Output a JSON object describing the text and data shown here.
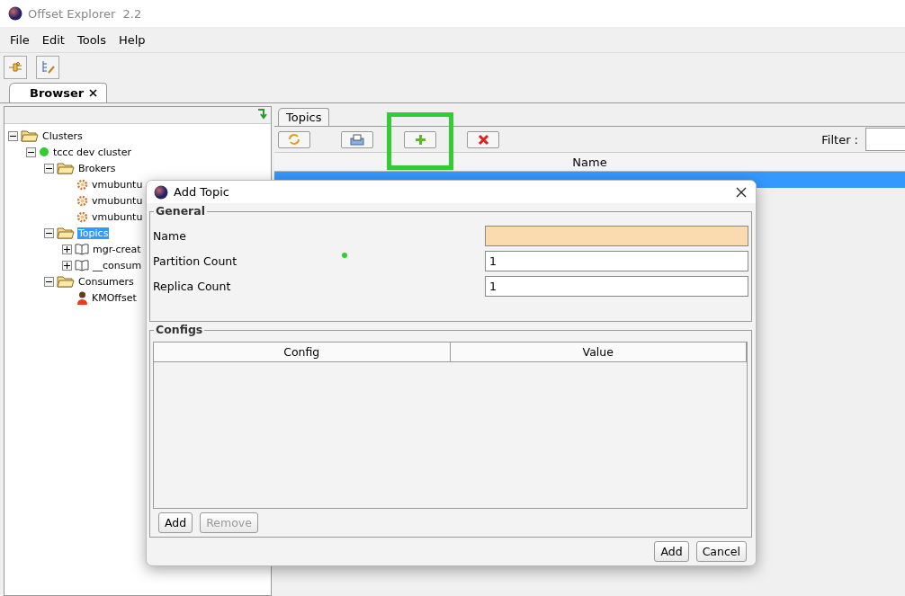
{
  "window": {
    "title": "Offset Explorer  2.2"
  },
  "menu": [
    "File",
    "Edit",
    "Tools",
    "Help"
  ],
  "browser_tab": {
    "label": "Browser",
    "selected": true
  },
  "tree": [
    {
      "label": "Clusters",
      "kind": "folder",
      "expanded": true,
      "selected": false,
      "children": [
        {
          "label": "tccc dev cluster",
          "kind": "cluster",
          "expanded": true,
          "selected": false,
          "children": [
            {
              "label": "Brokers",
              "kind": "folder",
              "expanded": true,
              "selected": false,
              "children": [
                {
                  "label": "vmubuntu",
                  "kind": "broker",
                  "selected": false
                },
                {
                  "label": "vmubuntu",
                  "kind": "broker",
                  "selected": false
                },
                {
                  "label": "vmubuntu",
                  "kind": "broker",
                  "selected": false
                }
              ]
            },
            {
              "label": "Topics",
              "kind": "folder",
              "expanded": true,
              "selected": true,
              "children": [
                {
                  "label": "mgr-creat",
                  "kind": "topic",
                  "expanded": false,
                  "selected": false
                },
                {
                  "label": "__consum",
                  "kind": "topic",
                  "expanded": false,
                  "selected": false
                }
              ]
            },
            {
              "label": "Consumers",
              "kind": "folder",
              "expanded": true,
              "selected": false,
              "children": [
                {
                  "label": "KMOffset",
                  "kind": "consumer",
                  "selected": false
                }
              ]
            }
          ]
        }
      ]
    }
  ],
  "topics_panel": {
    "tab": {
      "label": "Topics",
      "selected": true
    },
    "filter_label": "Filter :",
    "columns": [
      "Name"
    ],
    "rows": [
      {
        "selected": true
      }
    ]
  },
  "dialog": {
    "title": "Add Topic",
    "general_title": "General",
    "fields": [
      {
        "label": "Name",
        "required": true
      },
      {
        "label": "Partition Count",
        "value": "1",
        "required": false
      },
      {
        "label": "Replica Count",
        "value": "1",
        "required": false
      }
    ],
    "configs_title": "Configs",
    "config_columns": [
      "Config",
      "Value"
    ],
    "config_buttons": [
      {
        "label": "Add",
        "disabled": false
      },
      {
        "label": "Remove",
        "disabled": true
      }
    ],
    "buttons": [
      "Add",
      "Cancel"
    ]
  }
}
